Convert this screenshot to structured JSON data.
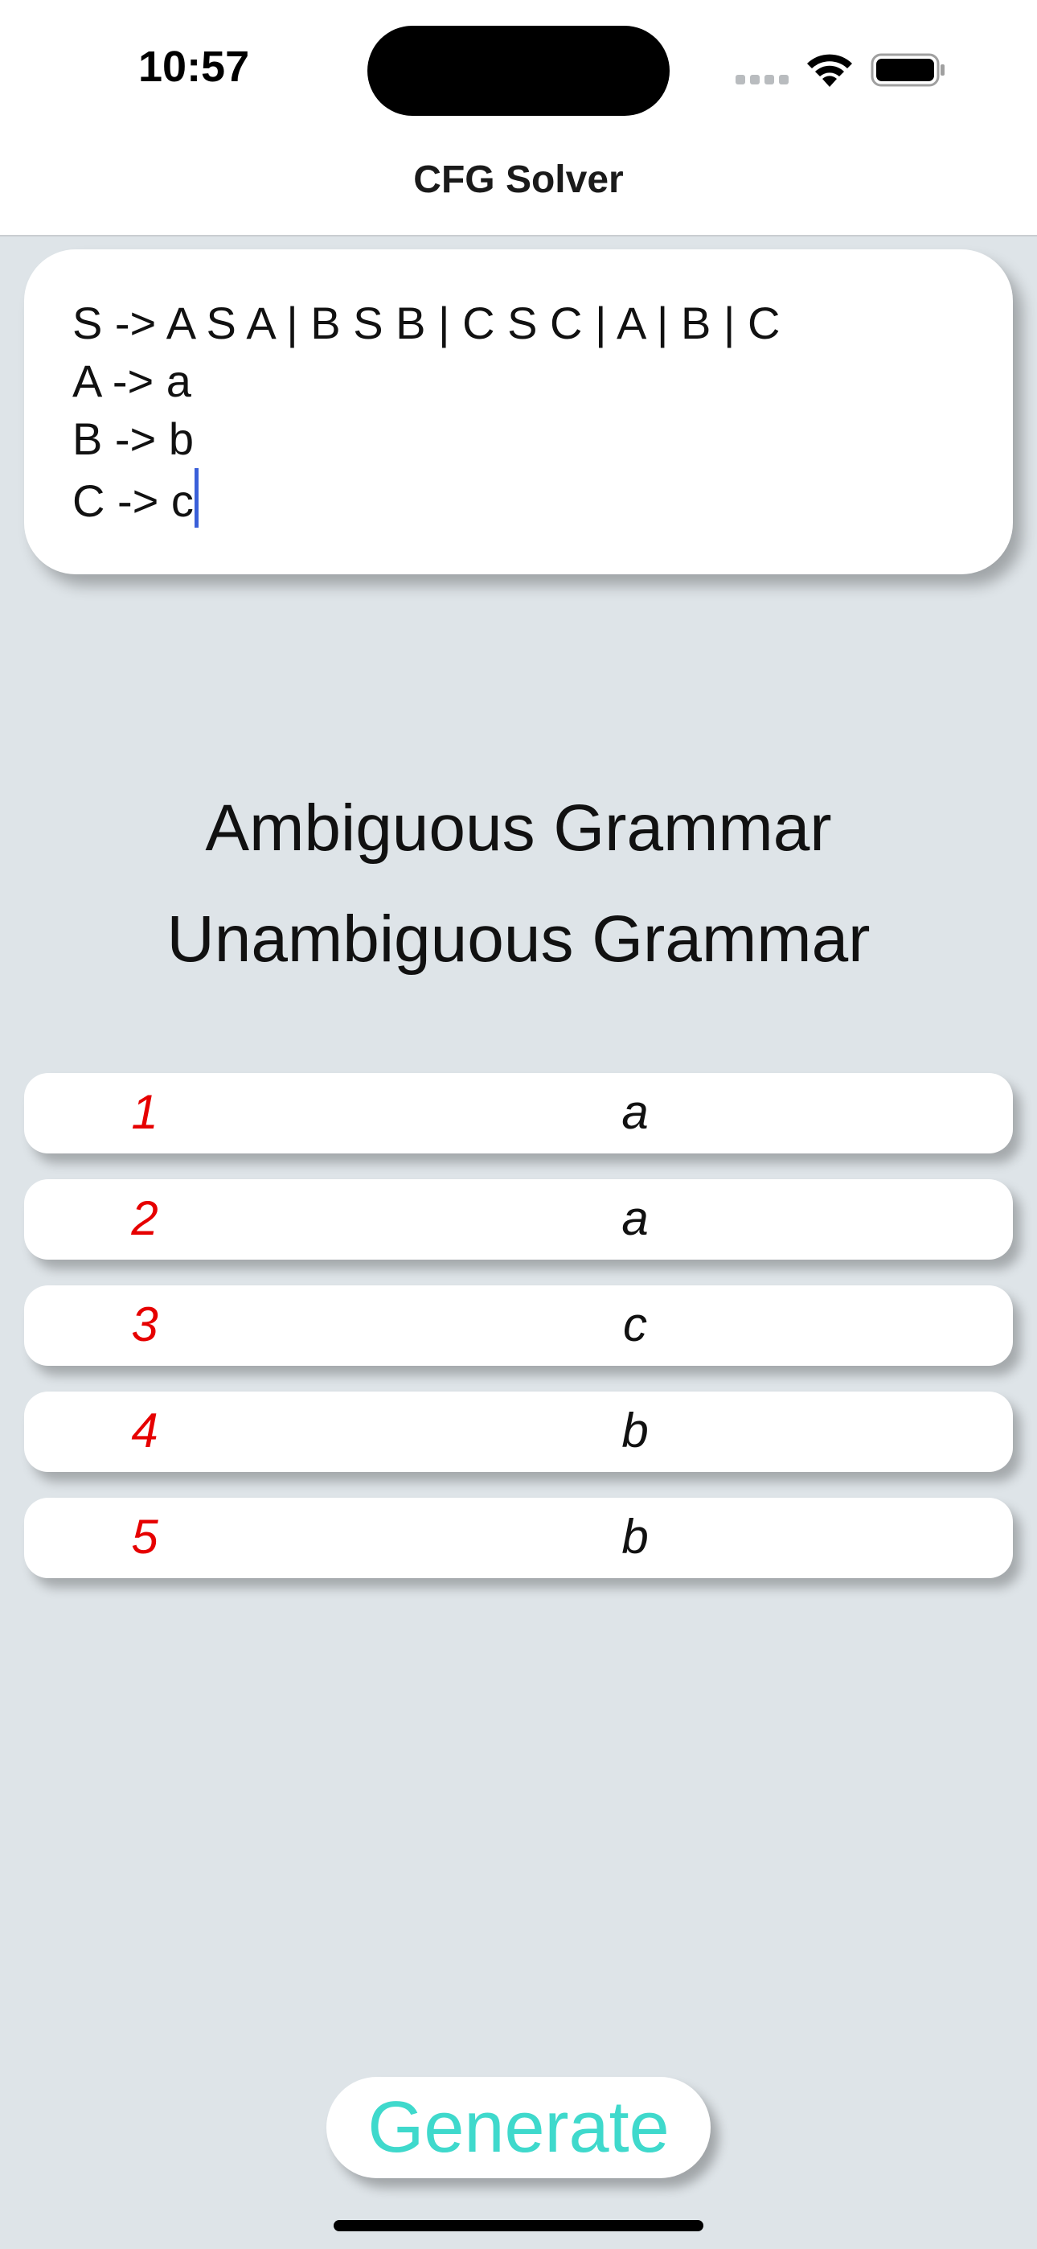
{
  "status_bar": {
    "time": "10:57"
  },
  "nav": {
    "title": "CFG Solver"
  },
  "grammar": {
    "lines": [
      "S -> A S A | B S B | C S C | A | B | C",
      "A -> a",
      "B -> b",
      "C -> c"
    ]
  },
  "results": {
    "ambiguous": "Ambiguous Grammar",
    "unambiguous": "Unambiguous Grammar"
  },
  "derivation": [
    {
      "index": "1",
      "symbol": "a"
    },
    {
      "index": "2",
      "symbol": "a"
    },
    {
      "index": "3",
      "symbol": "c"
    },
    {
      "index": "4",
      "symbol": "b"
    },
    {
      "index": "5",
      "symbol": "b"
    }
  ],
  "actions": {
    "generate_label": "Generate"
  },
  "colors": {
    "background": "#dee4e8",
    "index_red": "#e60000",
    "generate_teal": "#3fd9cc",
    "caret_blue": "#3a5fd9"
  },
  "icons": [
    "cellular-signal-icon",
    "wifi-icon",
    "battery-icon"
  ]
}
